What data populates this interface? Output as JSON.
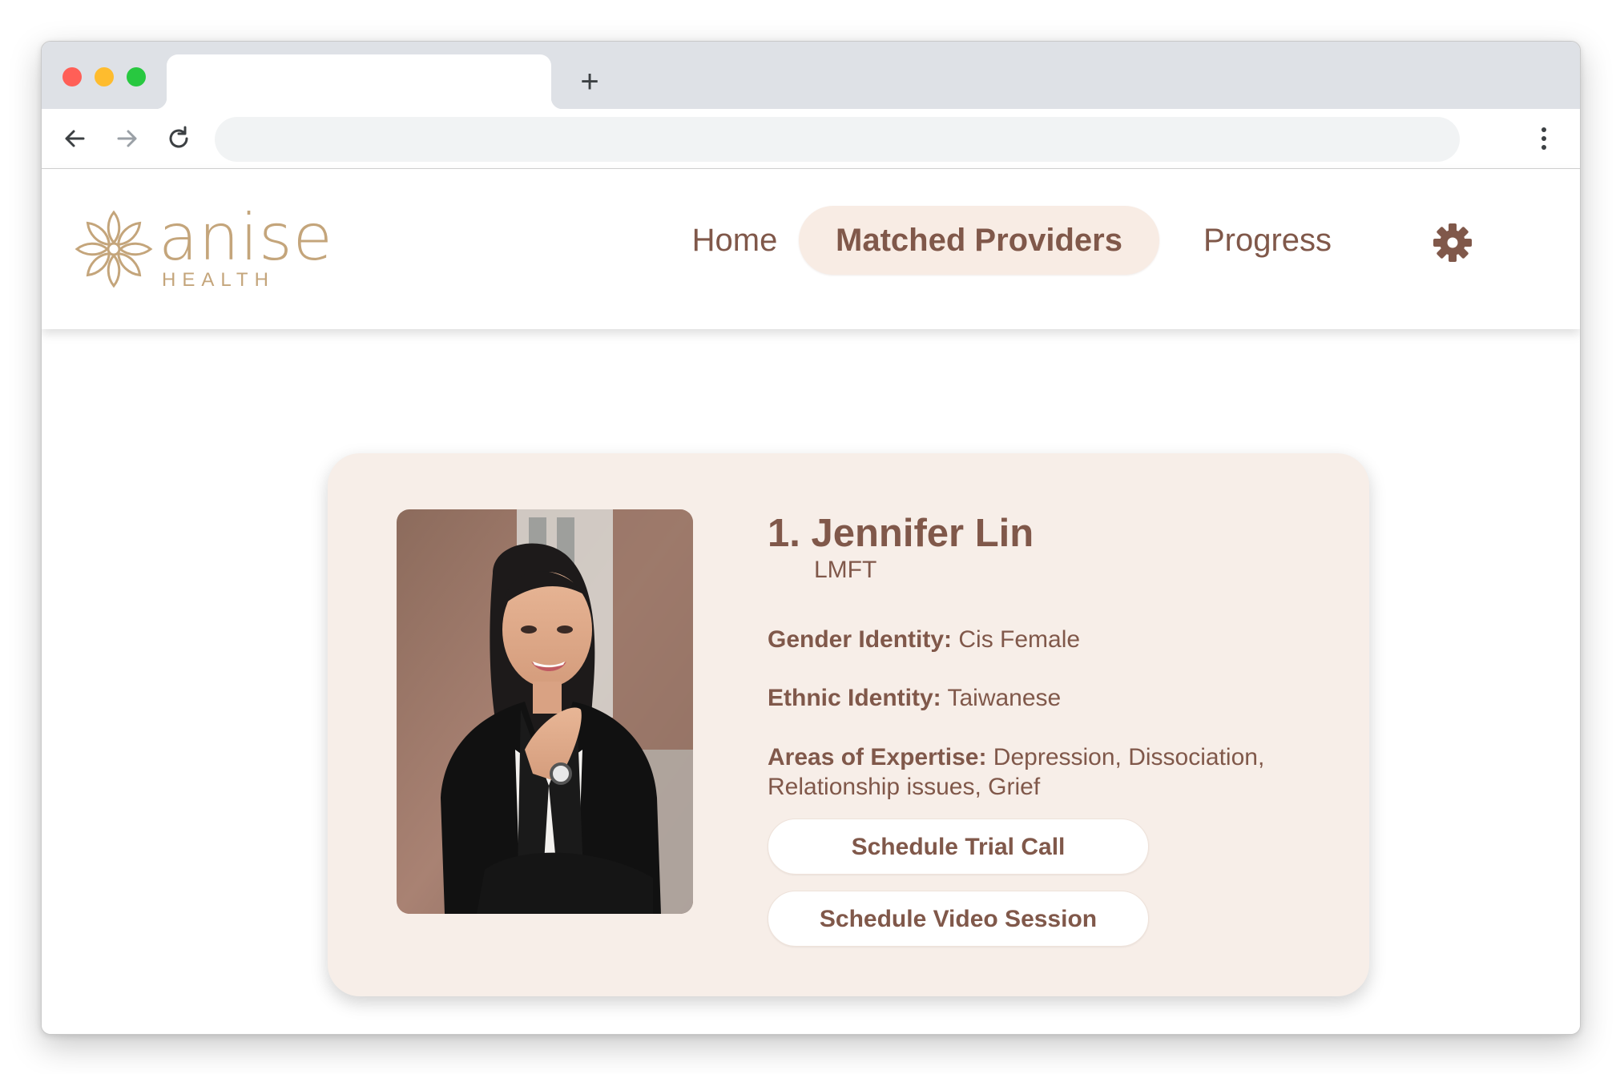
{
  "browser": {
    "tab_title": "",
    "new_tab_label": "+",
    "address_value": ""
  },
  "site": {
    "logo": {
      "word": "anise",
      "sub": "HEALTH",
      "icon": "flower-logo-icon"
    },
    "nav": {
      "home": "Home",
      "matched_providers": "Matched Providers",
      "progress": "Progress",
      "settings_icon": "gear-icon"
    }
  },
  "provider": {
    "name": "1. Jennifer Lin",
    "credential": "LMFT",
    "photo": "provider-portrait",
    "fields": {
      "gender": {
        "label": "Gender Identity:",
        "value": "Cis Female"
      },
      "ethnic": {
        "label": "Ethnic Identity:",
        "value": "Taiwanese"
      },
      "areas": {
        "label": "Areas of Expertise:",
        "value": "Depression, Dissociation, Relationship issues, Grief"
      }
    },
    "actions": {
      "trial_call": "Schedule Trial Call",
      "video_session": "Schedule Video Session"
    }
  },
  "colors": {
    "brand_brown": "#80584a",
    "brand_gold": "#c4a57b",
    "card_bg": "#f7eee8",
    "pill_bg": "#f8ece4"
  }
}
